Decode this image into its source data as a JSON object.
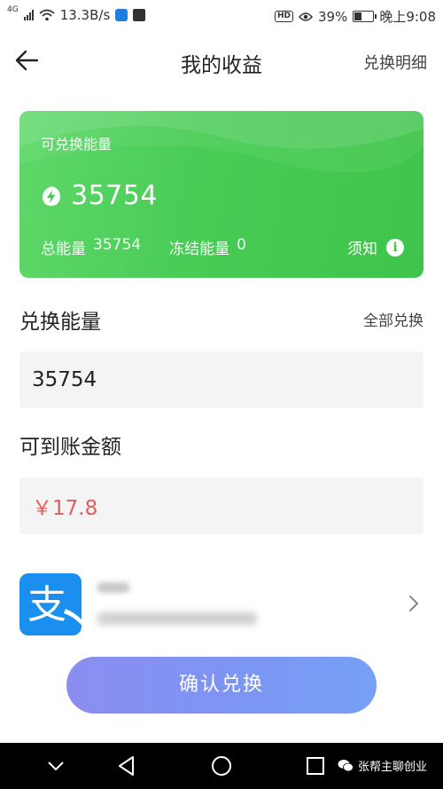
{
  "status_bar": {
    "network_label": "4G",
    "speed": "13.3B/s",
    "hd_label": "HD",
    "battery_text": "39%",
    "battery_level": 0.39,
    "time": "晚上9:08"
  },
  "header": {
    "title": "我的收益",
    "right_link": "兑换明细"
  },
  "energy_card": {
    "label": "可兑换能量",
    "amount": "35754",
    "total_label": "总能量",
    "total_value": "35754",
    "frozen_label": "冻结能量",
    "frozen_value": "0",
    "notice_label": "须知",
    "info_glyph": "i"
  },
  "exchange": {
    "title": "兑换能量",
    "all_link": "全部兑换",
    "value": "35754"
  },
  "arrival": {
    "title": "可到账金额",
    "value": "￥17.8"
  },
  "payment": {
    "logo_char": "支"
  },
  "confirm_button": "确认兑换",
  "watermark": "张帮主聊创业",
  "colors": {
    "card_green": "#48cc55",
    "amount_red": "#e35d5b",
    "button_purple": "#7d95f3",
    "alipay_blue": "#1a8ff0"
  }
}
